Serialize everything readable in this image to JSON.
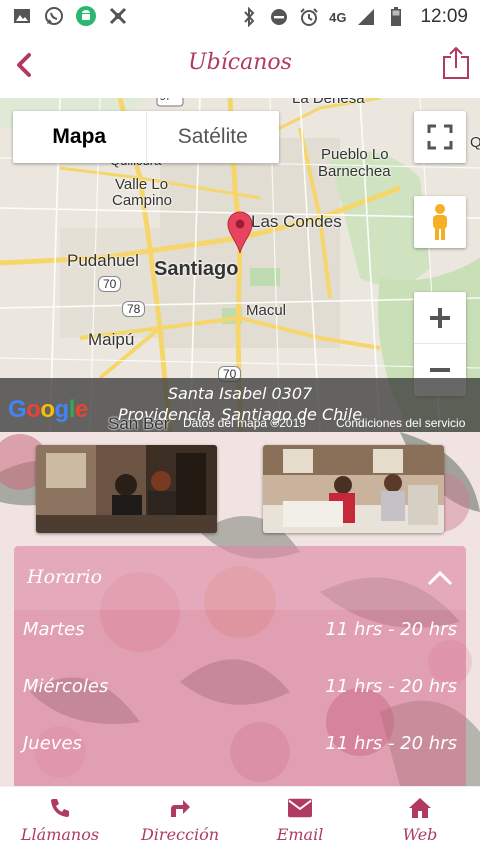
{
  "status_bar": {
    "network": "4G",
    "time": "12:09",
    "icons_left": [
      "gallery-icon",
      "whatsapp-icon",
      "android-icon",
      "crossed-tool-icon"
    ],
    "icons_right": [
      "bluetooth-icon",
      "do-not-disturb-icon",
      "alarm-icon",
      "signal-icon",
      "battery-icon"
    ]
  },
  "header": {
    "title": "Ubícanos",
    "accent_color": "#b03a62"
  },
  "map": {
    "type_options": [
      "Mapa",
      "Satélite"
    ],
    "selected_type": "Mapa",
    "labels": {
      "la_dehesa": "La Dehesa",
      "pueblo_lo": "Pueblo Lo",
      "barnechea": "Barnechea",
      "quilicura": "Quilicura",
      "valle_lo": "Valle Lo",
      "campino": "Campino",
      "las_condes": "Las Condes",
      "pudahuel": "Pudahuel",
      "santiago": "Santiago",
      "macul": "Macul",
      "maipu": "Maipú",
      "san_ber": "San Ber",
      "route_57": "57",
      "route_70a": "70",
      "route_78": "78",
      "route_70b": "70",
      "q_edge": "Q"
    },
    "address_line1": "Santa Isabel 0307",
    "address_line2": "Providencia, Santiago de Chile",
    "google_logo": "Google",
    "legal_data": "Datos del mapa ©2019",
    "legal_terms": "Condiciones del servicio"
  },
  "schedule": {
    "title": "Horario",
    "rows": [
      {
        "day": "Martes",
        "hours": "11 hrs - 20 hrs"
      },
      {
        "day": "Miércoles",
        "hours": "11 hrs - 20 hrs"
      },
      {
        "day": "Jueves",
        "hours": "11 hrs - 20 hrs"
      }
    ]
  },
  "bottom_nav": [
    {
      "label": "Llámanos",
      "icon": "phone-icon"
    },
    {
      "label": "Dirección",
      "icon": "direction-arrow-icon"
    },
    {
      "label": "Email",
      "icon": "envelope-icon"
    },
    {
      "label": "Web",
      "icon": "home-icon"
    }
  ]
}
